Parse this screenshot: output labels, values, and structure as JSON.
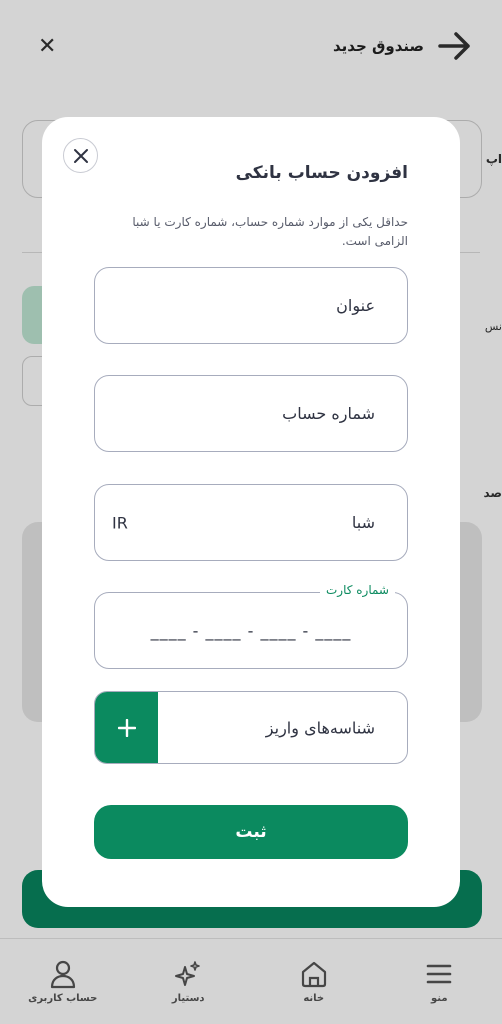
{
  "background": {
    "header_title": "صندوق جدید",
    "side_text_1": "اپ",
    "side_text_2": "نس",
    "side_text_3": "صد",
    "nav": [
      {
        "label": "حساب کاربری",
        "icon": "user-icon"
      },
      {
        "label": "دستیار",
        "icon": "sparkle-icon"
      },
      {
        "label": "خانه",
        "icon": "home-icon"
      },
      {
        "label": "منو",
        "icon": "menu-icon"
      }
    ]
  },
  "modal": {
    "title": "افزودن حساب بانکی",
    "description": "حداقل یکی از موارد شماره حساب، شماره کارت یا شبا الزامی است.",
    "fields": {
      "title_label": "عنوان",
      "account_label": "شماره حساب",
      "sheba_label": "شبا",
      "sheba_prefix": "IR",
      "card_label": "شماره کارت",
      "card_mask": "____ - ____ - ____ - ____"
    },
    "deposit_label": "شناسه‌های واریز",
    "submit_label": "ثبت"
  },
  "colors": {
    "accent": "#0b8a5f",
    "border": "#a7acbd",
    "text": "#2f3342",
    "overlay": "rgba(0,0,0,0.17)"
  }
}
